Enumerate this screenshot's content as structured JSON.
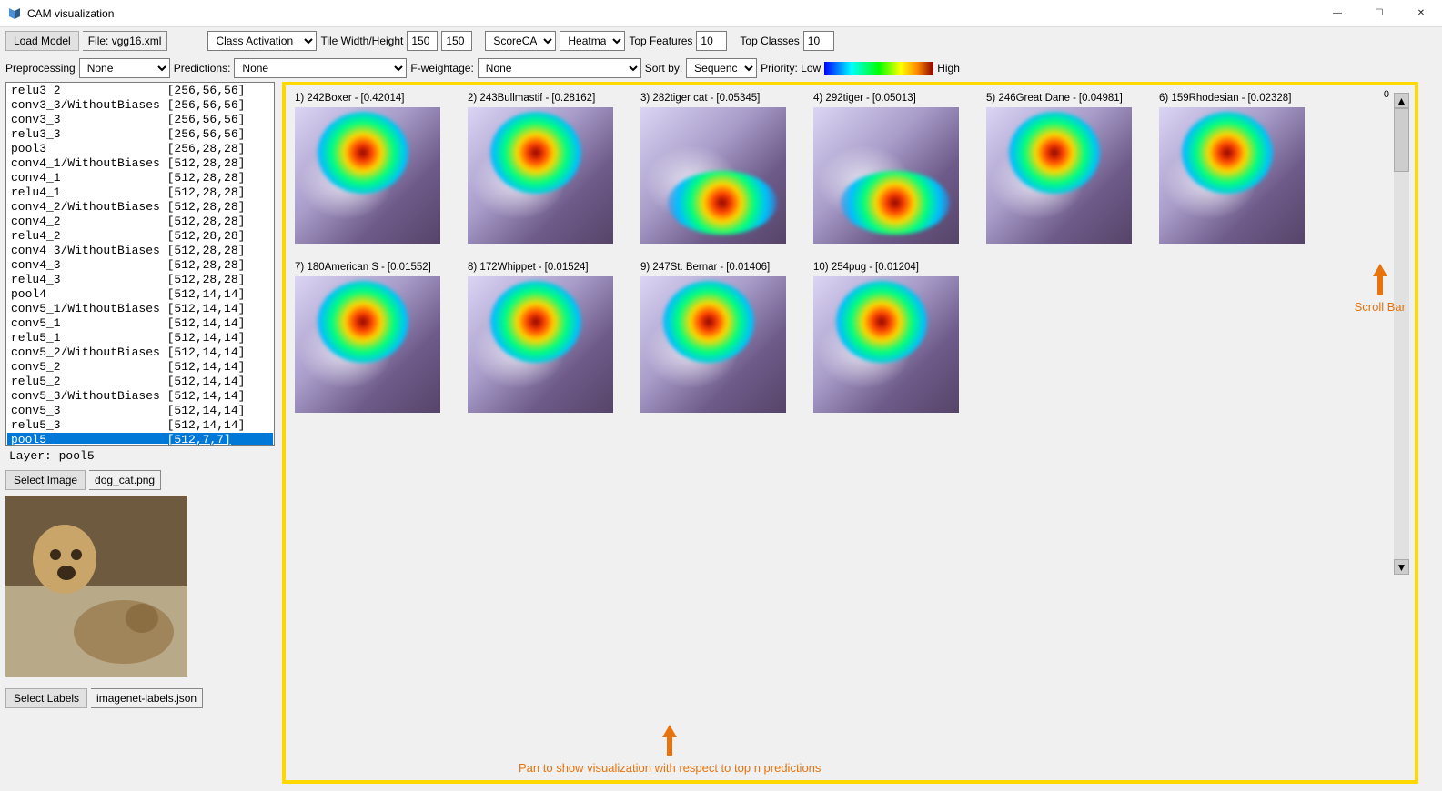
{
  "window": {
    "title": "CAM visualization",
    "min_icon": "—",
    "max_icon": "☐",
    "close_icon": "✕"
  },
  "toolbar1": {
    "load_model_btn": "Load Model",
    "file_label_prefix": "File: ",
    "file_name": "vgg16.xml",
    "class_activation_select": "Class Activation",
    "tile_wh_label": "Tile Width/Height",
    "tile_w": "150",
    "tile_h": "150",
    "scorecam_select": "ScoreCAM",
    "heatmap_select": "Heatmap",
    "top_features_label": "Top Features",
    "top_features_val": "10",
    "top_classes_label": "Top Classes",
    "top_classes_val": "10"
  },
  "toolbar2": {
    "preprocessing_label": "Preprocessing",
    "preprocessing_select": "None",
    "predictions_label": "Predictions:",
    "predictions_select": "None",
    "fweightage_label": "F-weightage:",
    "fweightage_select": "None",
    "sortby_label": "Sort by:",
    "sortby_select": "Sequence",
    "priority_low": "Priority: Low",
    "priority_high": "High"
  },
  "layers": [
    {
      "name": "relu3_2",
      "shape": "[256,56,56]"
    },
    {
      "name": "conv3_3/WithoutBiases",
      "shape": "[256,56,56]"
    },
    {
      "name": "conv3_3",
      "shape": "[256,56,56]"
    },
    {
      "name": "relu3_3",
      "shape": "[256,56,56]"
    },
    {
      "name": "pool3",
      "shape": "[256,28,28]"
    },
    {
      "name": "conv4_1/WithoutBiases",
      "shape": "[512,28,28]"
    },
    {
      "name": "conv4_1",
      "shape": "[512,28,28]"
    },
    {
      "name": "relu4_1",
      "shape": "[512,28,28]"
    },
    {
      "name": "conv4_2/WithoutBiases",
      "shape": "[512,28,28]"
    },
    {
      "name": "conv4_2",
      "shape": "[512,28,28]"
    },
    {
      "name": "relu4_2",
      "shape": "[512,28,28]"
    },
    {
      "name": "conv4_3/WithoutBiases",
      "shape": "[512,28,28]"
    },
    {
      "name": "conv4_3",
      "shape": "[512,28,28]"
    },
    {
      "name": "relu4_3",
      "shape": "[512,28,28]"
    },
    {
      "name": "pool4",
      "shape": "[512,14,14]"
    },
    {
      "name": "conv5_1/WithoutBiases",
      "shape": "[512,14,14]"
    },
    {
      "name": "conv5_1",
      "shape": "[512,14,14]"
    },
    {
      "name": "relu5_1",
      "shape": "[512,14,14]"
    },
    {
      "name": "conv5_2/WithoutBiases",
      "shape": "[512,14,14]"
    },
    {
      "name": "conv5_2",
      "shape": "[512,14,14]"
    },
    {
      "name": "relu5_2",
      "shape": "[512,14,14]"
    },
    {
      "name": "conv5_3/WithoutBiases",
      "shape": "[512,14,14]"
    },
    {
      "name": "conv5_3",
      "shape": "[512,14,14]"
    },
    {
      "name": "relu5_3",
      "shape": "[512,14,14]"
    },
    {
      "name": "pool5",
      "shape": "[512,7,7]"
    }
  ],
  "layer_selected_index": 24,
  "layer_label_prefix": "Layer:  ",
  "layer_label_value": "pool5",
  "select_image_btn": "Select Image",
  "select_image_file": "dog_cat.png",
  "select_labels_btn": "Select Labels",
  "select_labels_file": "imagenet-labels.json",
  "tiles": [
    {
      "rank": 1,
      "id": 242,
      "name": "Boxer",
      "score": "0.42014",
      "blob": "top"
    },
    {
      "rank": 2,
      "id": 243,
      "name": "Bullmastif",
      "score": "0.28162",
      "blob": "top"
    },
    {
      "rank": 3,
      "id": 282,
      "name": "tiger cat",
      "score": "0.05345",
      "blob": "bottom"
    },
    {
      "rank": 4,
      "id": 292,
      "name": "tiger",
      "score": "0.05013",
      "blob": "bottom"
    },
    {
      "rank": 5,
      "id": 246,
      "name": "Great Dane",
      "score": "0.04981",
      "blob": "top"
    },
    {
      "rank": 6,
      "id": 159,
      "name": "Rhodesian",
      "score": "0.02328",
      "blob": "top"
    },
    {
      "rank": 7,
      "id": 180,
      "name": "American S",
      "score": "0.01552",
      "blob": "top"
    },
    {
      "rank": 8,
      "id": 172,
      "name": "Whippet",
      "score": "0.01524",
      "blob": "top"
    },
    {
      "rank": 9,
      "id": 247,
      "name": "St. Bernar",
      "score": "0.01406",
      "blob": "top"
    },
    {
      "rank": 10,
      "id": 254,
      "name": "pug",
      "score": "0.01204",
      "blob": "top"
    }
  ],
  "scroll_value": "0",
  "annotations": {
    "scrollbar": "Scroll Bar",
    "pan": "Pan to show visualization with respect to top n predictions"
  }
}
